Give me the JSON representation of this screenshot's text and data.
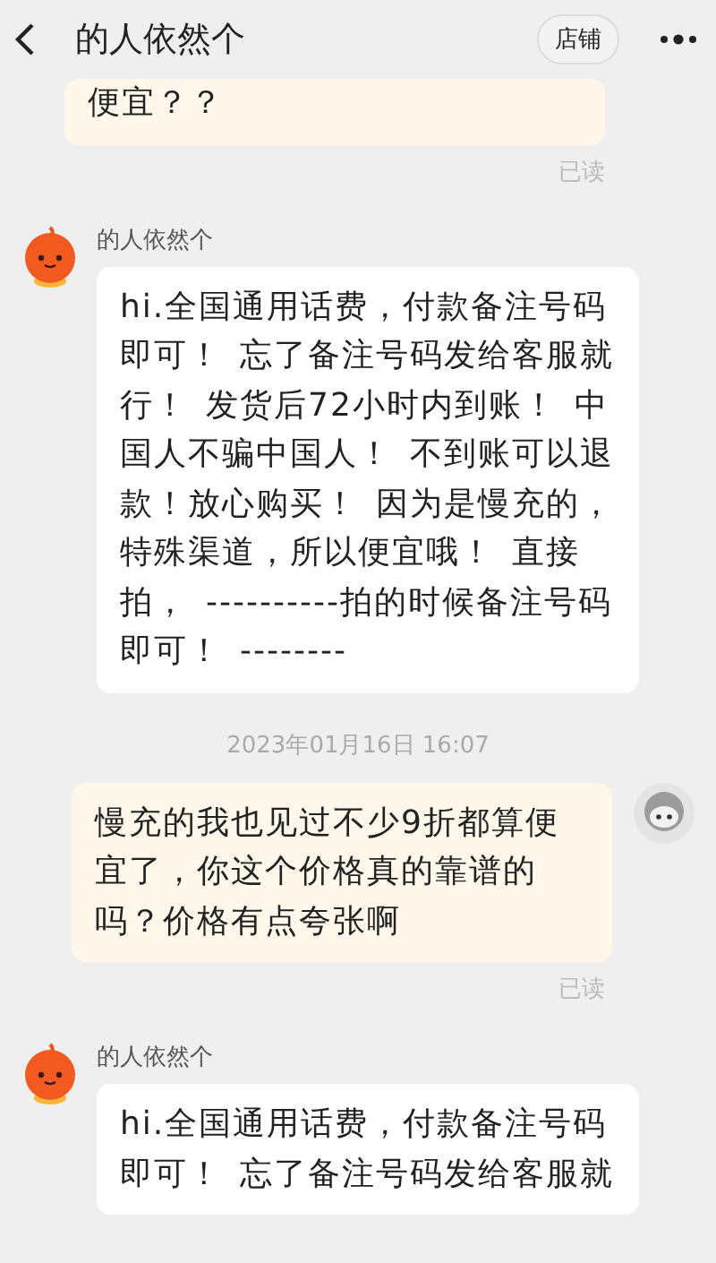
{
  "header": {
    "title": "的人依然个",
    "shop_button": "店铺"
  },
  "messages": [
    {
      "kind": "outgoing",
      "text": "便宜？？",
      "status": "已读",
      "cut_top": true
    },
    {
      "kind": "incoming",
      "sender": "的人依然个",
      "text": "hi.全国通用话费，付款备注号码即可！ 忘了备注号码发给客服就行！ 发货后72小时内到账！ 中国人不骗中国人！ 不到账可以退款！放心购买！ 因为是慢充的，特殊渠道，所以便宜哦！ 直接拍， ----------拍的时候备注号码即可！ --------"
    },
    {
      "kind": "time",
      "text": "2023年01月16日 16:07"
    },
    {
      "kind": "outgoing",
      "text": "慢充的我也见过不少9折都算便宜了，你这个价格真的靠谱的吗？价格有点夸张啊",
      "status": "已读"
    },
    {
      "kind": "incoming",
      "sender": "的人依然个",
      "text": "hi.全国通用话费，付款备注号码即可！ 忘了备注号码发给客服就"
    }
  ]
}
